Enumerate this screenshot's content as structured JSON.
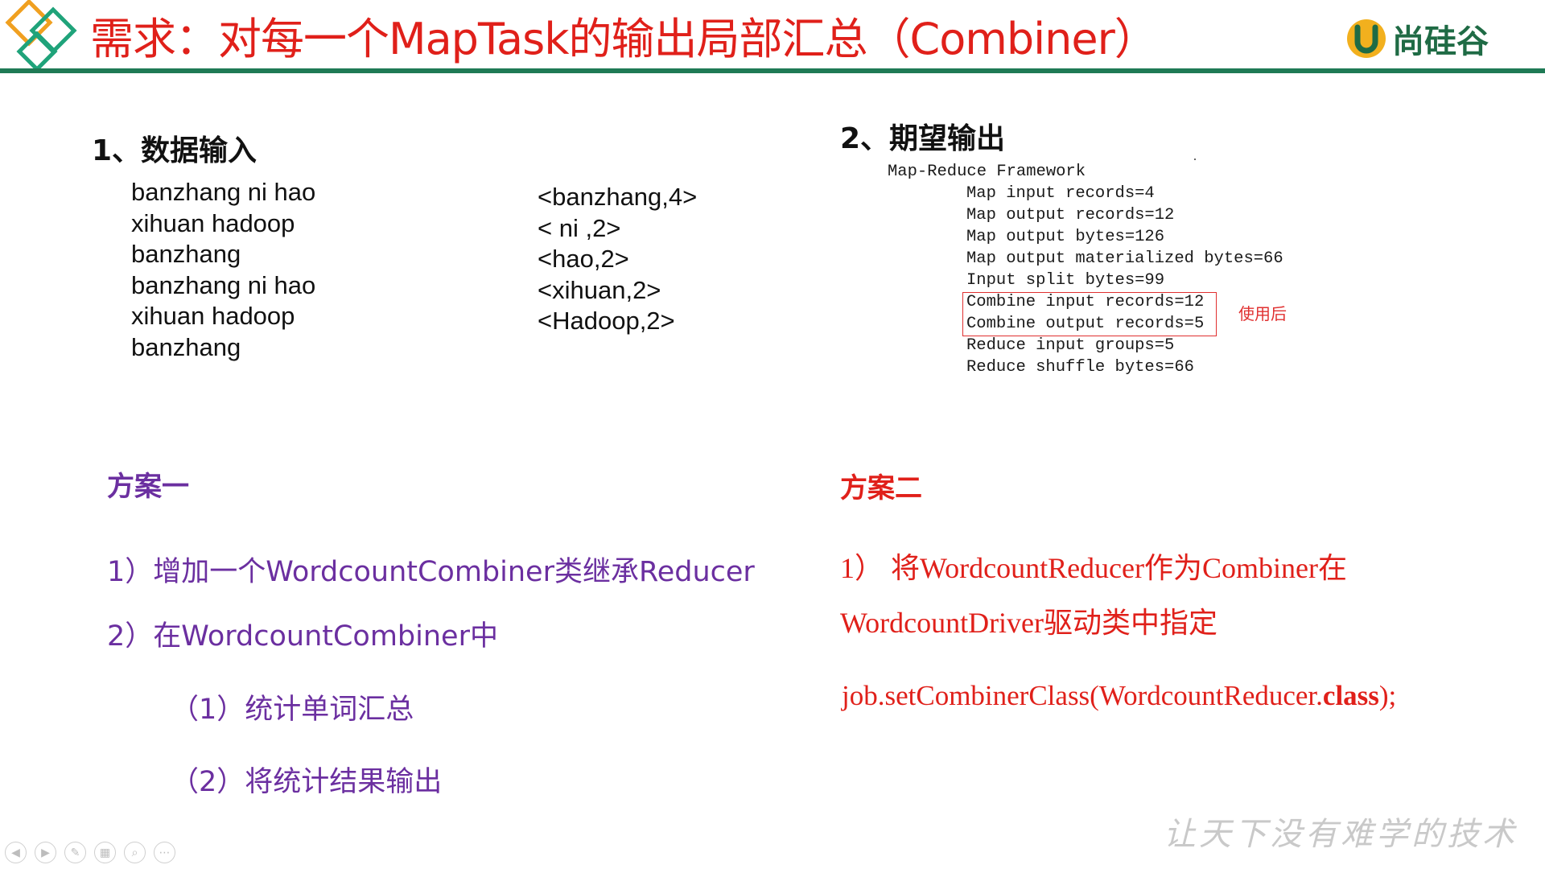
{
  "header": {
    "title": "需求：对每一个MapTask的输出局部汇总（Combiner）",
    "brand": "尚硅谷",
    "accent_color": "#1f7a55",
    "title_color": "#e0201a"
  },
  "input_section": {
    "heading": "1、数据输入",
    "lines": [
      "banzhang ni hao",
      "xihuan hadoop",
      "banzhang",
      "banzhang ni hao",
      "xihuan hadoop",
      "banzhang"
    ],
    "pairs": [
      "<banzhang,4>",
      "< ni ,2>",
      "<hao,2>",
      "<xihuan,2>",
      "<Hadoop,2>"
    ]
  },
  "output_section": {
    "heading": "2、期望输出",
    "framework_label": "Map-Reduce Framework",
    "counters": [
      "Map input records=4",
      "Map output records=12",
      "Map output bytes=126",
      "Map output materialized bytes=66",
      "Input split bytes=99",
      "Combine input records=12",
      "Combine output records=5",
      "Reduce input groups=5",
      "Reduce shuffle bytes=66"
    ],
    "note": "使用后"
  },
  "plan1": {
    "title": "方案一",
    "step1": "1）增加一个WordcountCombiner类继承Reducer",
    "step2": "2）在WordcountCombiner中",
    "step2a": "（1）统计单词汇总",
    "step2b": "（2）将统计结果输出"
  },
  "plan2": {
    "title": "方案二",
    "step1_line1": "1） 将WordcountReducer作为Combiner在",
    "step1_line2": "WordcountDriver驱动类中指定",
    "code_prefix": "job.setCombinerClass(WordcountReducer.",
    "code_keyword": "class",
    "code_suffix": ");"
  },
  "footer": {
    "slogan": "让天下没有难学的技术",
    "nav_icons": [
      "prev-icon",
      "next-icon",
      "pen-icon",
      "slides-icon",
      "zoom-icon",
      "more-icon"
    ]
  }
}
